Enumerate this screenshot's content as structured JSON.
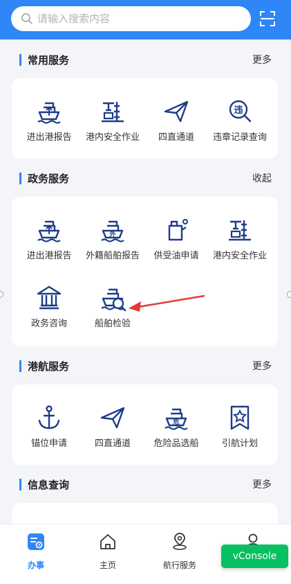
{
  "search": {
    "placeholder": "请输入搜索内容"
  },
  "colors": {
    "primary": "#2f86f6",
    "icon": "#1d3c8a",
    "vconsole": "#07c160",
    "arrow": "#e53935"
  },
  "sections": {
    "common": {
      "title": "常用服务",
      "action": "更多",
      "items": [
        {
          "label": "进出港报告",
          "icon": "ship-in-out-icon"
        },
        {
          "label": "港内安全作业",
          "icon": "port-crane-icon"
        },
        {
          "label": "四直通道",
          "icon": "paper-plane-icon"
        },
        {
          "label": "违章记录查询",
          "icon": "violation-search-icon"
        }
      ]
    },
    "gov": {
      "title": "政务服务",
      "action": "收起",
      "items": [
        {
          "label": "进出港报告",
          "icon": "ship-in-out-icon"
        },
        {
          "label": "外籍船舶报告",
          "icon": "foreign-ship-icon"
        },
        {
          "label": "供受油申请",
          "icon": "oil-can-icon"
        },
        {
          "label": "港内安全作业",
          "icon": "port-crane-icon"
        },
        {
          "label": "政务咨询",
          "icon": "government-building-icon"
        },
        {
          "label": "船舶检验",
          "icon": "ship-inspection-icon"
        }
      ]
    },
    "port": {
      "title": "港航服务",
      "action": "更多",
      "items": [
        {
          "label": "锚位申请",
          "icon": "anchor-icon"
        },
        {
          "label": "四直通道",
          "icon": "paper-plane-icon"
        },
        {
          "label": "危险品选船",
          "icon": "hazard-ship-icon"
        },
        {
          "label": "引航计划",
          "icon": "pilot-plan-icon"
        }
      ]
    },
    "info": {
      "title": "信息查询",
      "action": "更多"
    }
  },
  "tabbar": [
    {
      "label": "办事",
      "icon": "services-icon",
      "active": true
    },
    {
      "label": "主页",
      "icon": "home-icon",
      "active": false
    },
    {
      "label": "航行服务",
      "icon": "navigation-location-icon",
      "active": false
    },
    {
      "label": "",
      "icon": "user-icon",
      "active": false
    }
  ],
  "vconsole": "vConsole"
}
